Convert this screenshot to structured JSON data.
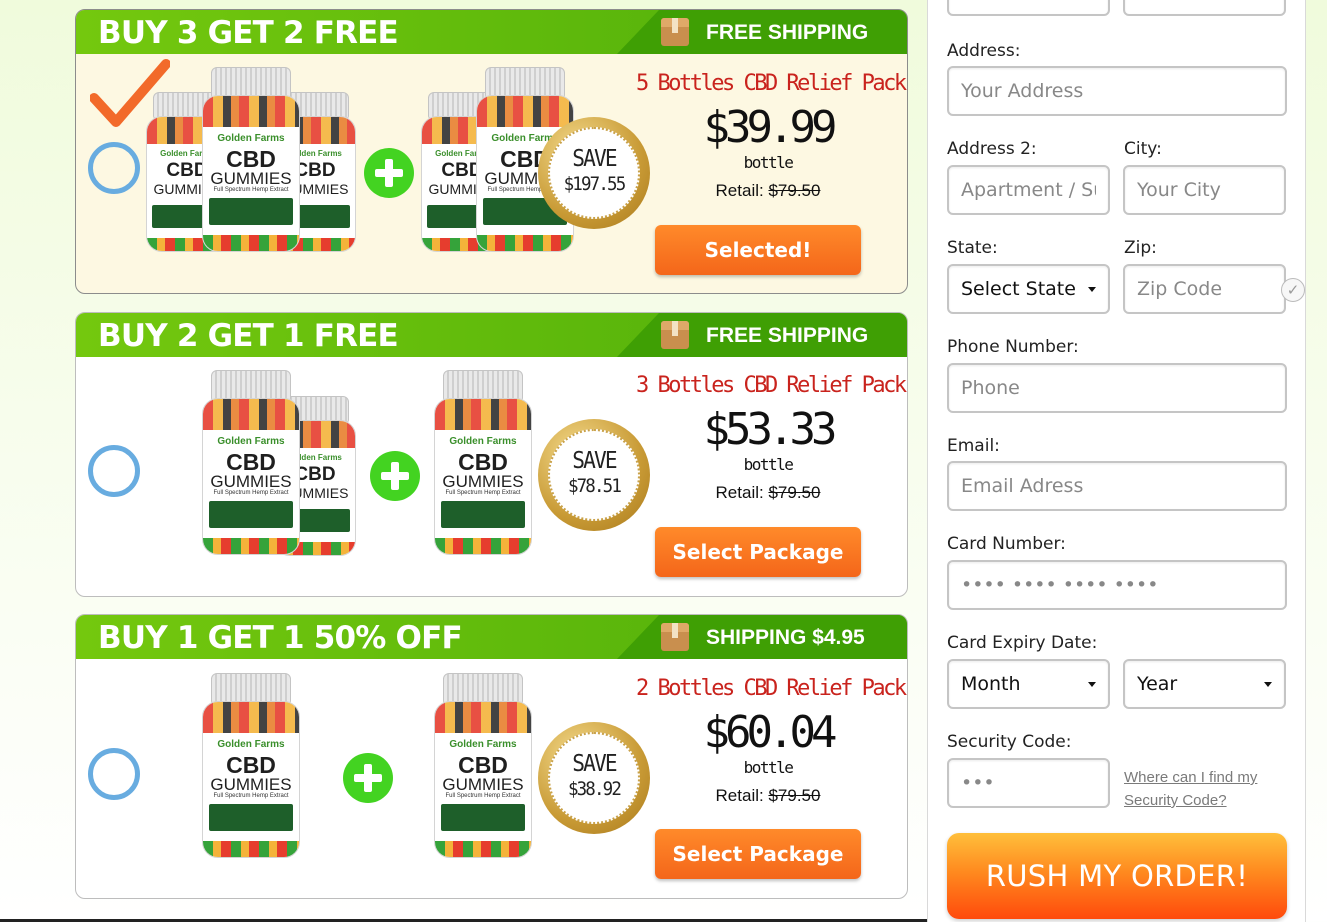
{
  "packages": [
    {
      "title": "BUY 3 GET 2 FREE",
      "shipping": "FREE SHIPPING",
      "pack_name": "5 Bottles CBD Relief Pack",
      "price": "$39.99",
      "unit": "bottle",
      "retail_label": "Retail:",
      "retail_price": "$79.50",
      "save_label": "SAVE",
      "save_amount": "$197.55",
      "button": "Selected!",
      "selected": true
    },
    {
      "title": "BUY 2 GET 1 FREE",
      "shipping": "FREE SHIPPING",
      "pack_name": "3 Bottles CBD Relief Pack",
      "price": "$53.33",
      "unit": "bottle",
      "retail_label": "Retail:",
      "retail_price": "$79.50",
      "save_label": "SAVE",
      "save_amount": "$78.51",
      "button": "Select Package",
      "selected": false
    },
    {
      "title": "BUY 1 GET 1 50% OFF",
      "shipping": "SHIPPING $4.95",
      "pack_name": "2 Bottles CBD Relief Pack",
      "price": "$60.04",
      "unit": "bottle",
      "retail_label": "Retail:",
      "retail_price": "$79.50",
      "save_label": "SAVE",
      "save_amount": "$38.92",
      "button": "Select Package",
      "selected": false
    }
  ],
  "bottle_label": {
    "brand": "Golden Farms",
    "line1": "CBD",
    "line2": "GUMMIES",
    "sub": "Full Spectrum Hemp Extract"
  },
  "form": {
    "address_label": "Address:",
    "address_placeholder": "Your Address",
    "address2_label": "Address 2:",
    "address2_placeholder": "Apartment / Suite",
    "city_label": "City:",
    "city_placeholder": "Your City",
    "state_label": "State:",
    "state_value": "Select State",
    "zip_label": "Zip:",
    "zip_placeholder": "Zip Code",
    "phone_label": "Phone Number:",
    "phone_placeholder": "Phone",
    "email_label": "Email:",
    "email_placeholder": "Email Adress",
    "card_label": "Card Number:",
    "card_placeholder": "•••• •••• •••• ••••",
    "expiry_label": "Card Expiry Date:",
    "month_value": "Month",
    "year_value": "Year",
    "cvv_label": "Security Code:",
    "cvv_placeholder": "•••",
    "cvv_help_link": "Where can I find my Security Code?",
    "submit": "RUSH MY ORDER!"
  },
  "icons": {
    "selected_check": "checkmark-icon",
    "shipping": "package-box-icon",
    "plus": "plus-icon",
    "valid": "check-circle-icon"
  },
  "colors": {
    "header_green": "#5cb80b",
    "button_orange": "#f96d1e",
    "pack_red": "#c9231d",
    "radio_blue": "#68ace0"
  }
}
